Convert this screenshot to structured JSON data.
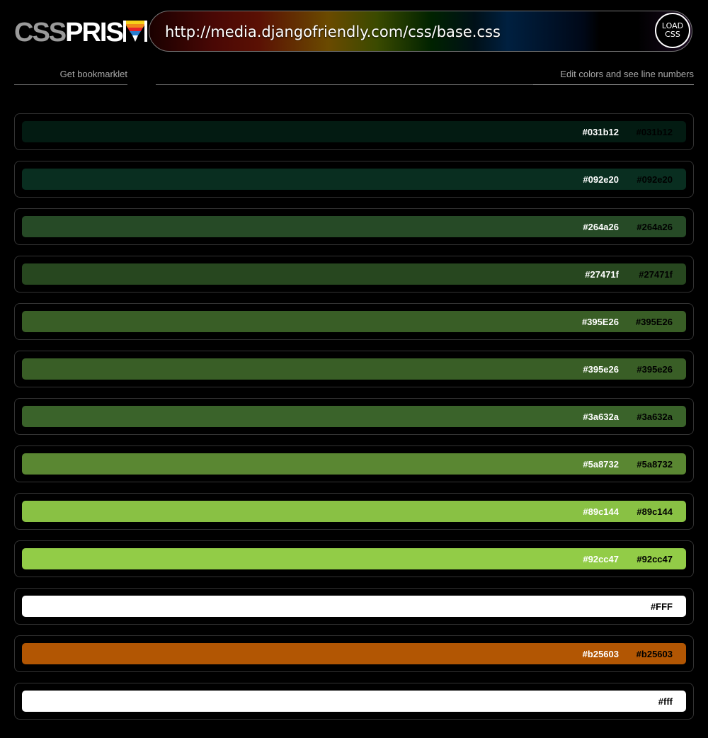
{
  "logo": {
    "part1": "CSS",
    "part2": "PRIS"
  },
  "url": {
    "value": "http://media.djangofriendly.com/css/base.css"
  },
  "load_button": {
    "line1": "LOAD",
    "line2": "CSS"
  },
  "links": {
    "bookmarklet": "Get bookmarklet",
    "edit": "Edit colors and see line numbers"
  },
  "colors": [
    {
      "hex": "#031b12",
      "label": "#031b12",
      "show_white": true
    },
    {
      "hex": "#092e20",
      "label": "#092e20",
      "show_white": true
    },
    {
      "hex": "#264a26",
      "label": "#264a26",
      "show_white": true
    },
    {
      "hex": "#27471f",
      "label": "#27471f",
      "show_white": true
    },
    {
      "hex": "#395E26",
      "label": "#395E26",
      "show_white": true
    },
    {
      "hex": "#395e26",
      "label": "#395e26",
      "show_white": true
    },
    {
      "hex": "#3a632a",
      "label": "#3a632a",
      "show_white": true
    },
    {
      "hex": "#5a8732",
      "label": "#5a8732",
      "show_white": true
    },
    {
      "hex": "#89c144",
      "label": "#89c144",
      "show_white": true
    },
    {
      "hex": "#92cc47",
      "label": "#92cc47",
      "show_white": true
    },
    {
      "hex": "#FFF",
      "label": "#FFF",
      "show_white": false
    },
    {
      "hex": "#b25603",
      "label": "#b25603",
      "show_white": true
    },
    {
      "hex": "#fff",
      "label": "#fff",
      "show_white": false
    }
  ]
}
